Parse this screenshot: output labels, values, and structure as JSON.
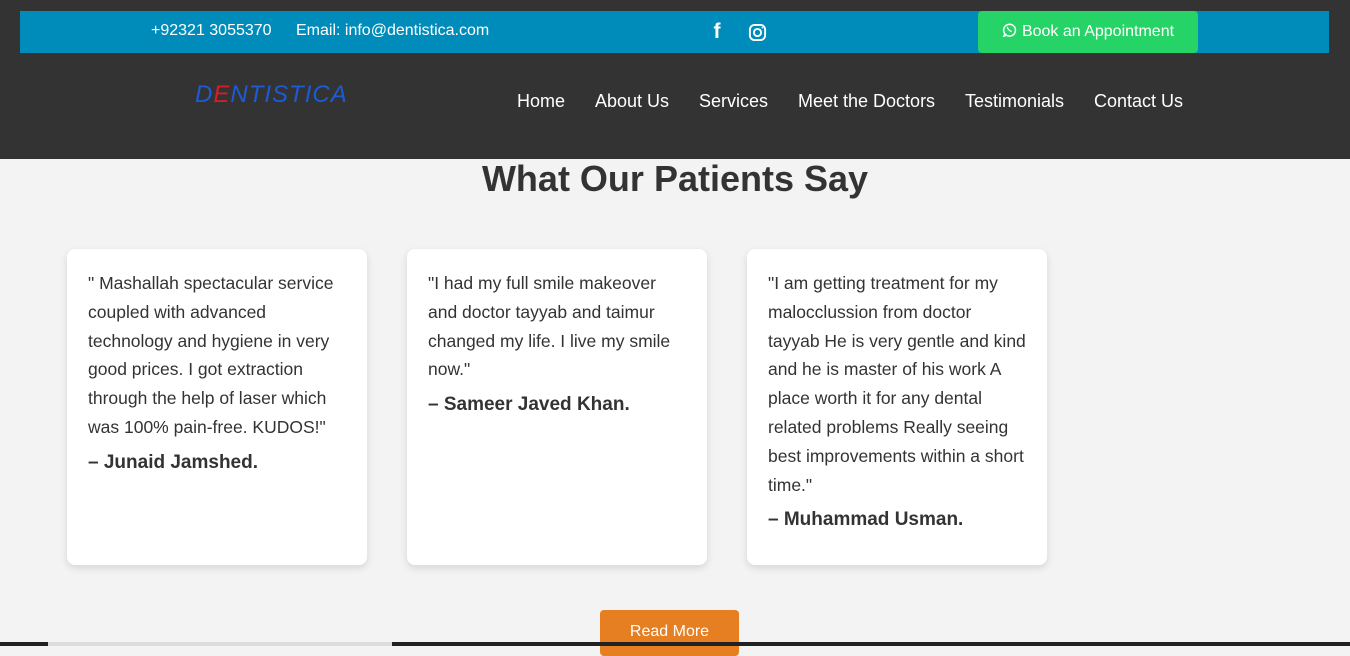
{
  "topbar": {
    "phone": "+92321 3055370",
    "email": "Email: info@dentistica.com",
    "facebook_icon": "facebook-icon",
    "instagram_icon": "instagram-icon",
    "book_label": "Book an Appointment",
    "book_icon": "whatsapp-icon"
  },
  "header": {
    "logo_first": "D",
    "logo_accent": "E",
    "logo_rest": "NTISTICA",
    "nav": [
      "Home",
      "About Us",
      "Services",
      "Meet the Doctors",
      "Testimonials",
      "Contact Us"
    ]
  },
  "testimonials": {
    "title": "What Our Patients Say",
    "items": [
      {
        "quote": "\" Mashallah spectacular service coupled with advanced technology and hygiene in very good prices. I got extraction through the help of laser which was 100% pain-free. KUDOS!\"",
        "author": "– Junaid Jamshed."
      },
      {
        "quote": "\"I had my full smile makeover and doctor tayyab and taimur changed my life. I live my smile now.\"",
        "author": "– Sameer Javed Khan."
      },
      {
        "quote": "\"I am getting treatment for my malocclussion from doctor tayyab He is very gentle and kind and he is master of his work A place worth it for any dental related problems Really seeing best improvements within a short time.\"",
        "author": "– Muhammad Usman."
      }
    ],
    "read_more": "Read More"
  },
  "colors": {
    "topbar": "#008cba",
    "header": "#333333",
    "book_button": "#25d366",
    "read_more": "#e67e22",
    "logo": "#1d5bd6",
    "logo_accent": "#d31f2b"
  }
}
